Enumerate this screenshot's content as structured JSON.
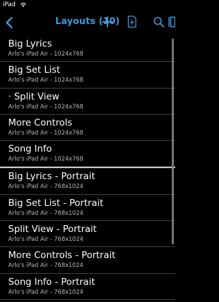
{
  "status": {
    "carrier": "iPad"
  },
  "nav": {
    "title": "Layouts (10)",
    "accent": "#3f9bd8"
  },
  "landscape": [
    {
      "name": "Big Lyrics",
      "sub": "Arlo's iPad Air - 1024x768"
    },
    {
      "name": "Big Set List",
      "sub": "Arlo's iPad Air - 1024x768"
    },
    {
      "name": "· Split View",
      "sub": "Arlo's iPad Air - 1024x768"
    },
    {
      "name": "More Controls",
      "sub": "Arlo's iPad Air - 1024x768"
    },
    {
      "name": "Song Info",
      "sub": "Arlo's iPad Air - 1024x768"
    }
  ],
  "portrait": [
    {
      "name": "Big Lyrics - Portrait",
      "sub": "Arlo's iPad Air - 768x1024"
    },
    {
      "name": "Big Set List - Portrait",
      "sub": "Arlo's iPad Air - 768x1024"
    },
    {
      "name": "Split View - Portrait",
      "sub": "Arlo's iPad Air - 768x1024"
    },
    {
      "name": "More Controls - Portrait",
      "sub": "Arlo's iPad Air - 768x1024"
    },
    {
      "name": "Song Info - Portrait",
      "sub": "Arlo's iPad Air - 768x1024"
    }
  ]
}
